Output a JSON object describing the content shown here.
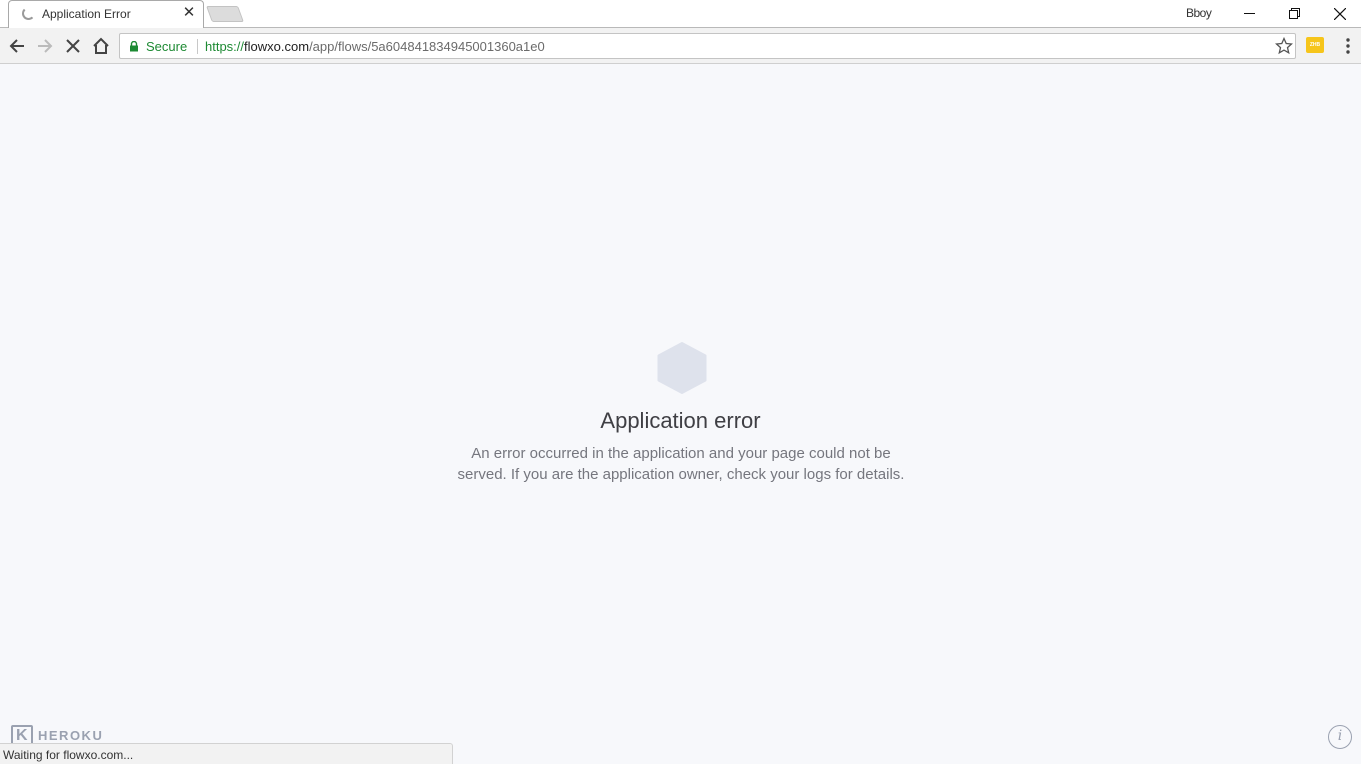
{
  "browser": {
    "tab": {
      "title": "Application Error"
    },
    "profile_name": "Bboy",
    "omnibox": {
      "security_label": "Secure",
      "url_scheme": "https://",
      "url_host": "flowxo.com",
      "url_path": "/app/flows/5a604841834945001360a1e0"
    },
    "extension_label": "ZHB",
    "status_text": "Waiting for flowxo.com..."
  },
  "page": {
    "title": "Application error",
    "message_line1": "An error occurred in the application and your page could not be",
    "message_line2": "served. If you are the application owner, check your logs for details.",
    "footer_logo_text": "HEROKU",
    "footer_logo_glyph": "K",
    "info_glyph": "i"
  },
  "colors": {
    "secure_green": "#1d8a33",
    "page_background": "#f7f8fb",
    "hexagon": "#dee2ec",
    "muted_logo": "#9aa1b0"
  }
}
